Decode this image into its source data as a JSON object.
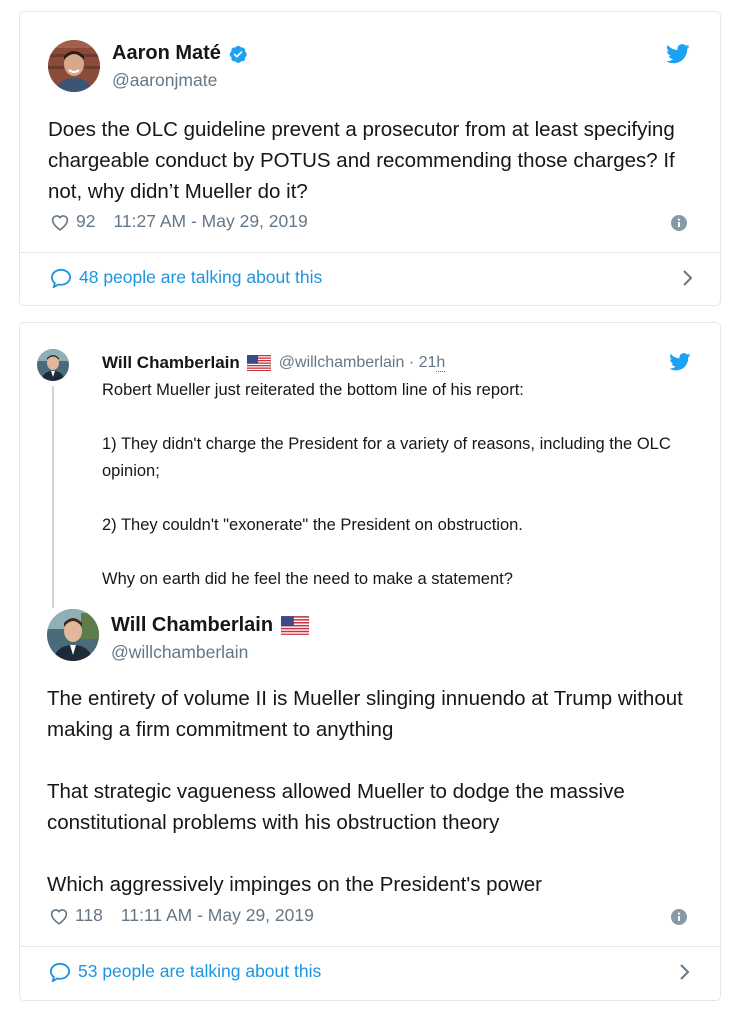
{
  "tweet1": {
    "name": "Aaron Maté",
    "handle": "@aaronjmate",
    "verified": true,
    "text": "Does the OLC guideline prevent a prosecutor from at least specifying chargeable conduct by POTUS and recommending those charges? If not, why didn’t Mueller do it?",
    "likes": "92",
    "timestamp": "11:27 AM - May 29, 2019",
    "talking": "48 people are talking about this"
  },
  "parent": {
    "name": "Will Chamberlain",
    "flag": "us-flag",
    "handle_time": "@willchamberlain · 21",
    "time_unit": "h",
    "text": "Robert Mueller just reiterated the bottom line of his report:\n\n1) They didn't charge the President for a variety of reasons, including the OLC opinion;\n\n2) They couldn't \"exonerate\" the President on obstruction.\n\nWhy on earth did he feel the need to make a statement?"
  },
  "tweet2": {
    "name": "Will Chamberlain",
    "flag": "us-flag",
    "handle": "@willchamberlain",
    "text": "The entirety of volume II is Mueller slinging innuendo at Trump without making a firm commitment to anything\n\nThat strategic vagueness allowed Mueller  to dodge the massive constitutional problems with his obstruction theory\n\nWhich aggressively impinges on the President's power",
    "likes": "118",
    "timestamp": "11:11 AM - May 29, 2019",
    "talking": "53 people are talking about this"
  },
  "colors": {
    "twitter_blue": "#1da1f2",
    "link_blue": "#1b95e0",
    "text_gray": "#657786",
    "border": "#e1e8ed"
  },
  "icons": {
    "bird": "twitter-bird-icon",
    "verified": "verified-badge-icon",
    "heart": "heart-icon",
    "info": "info-icon",
    "bubble": "speech-bubble-icon",
    "chevron": "chevron-right-icon"
  }
}
